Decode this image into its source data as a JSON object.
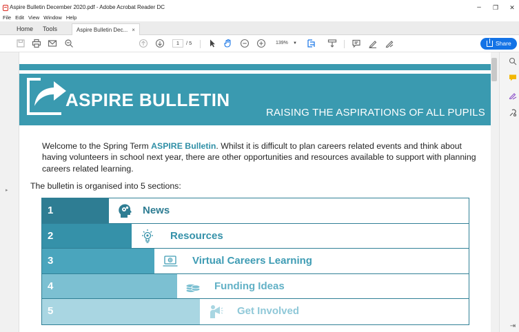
{
  "window": {
    "title": "Aspire Bulletin December 2020.pdf - Adobe Acrobat Reader DC",
    "minimize": "–",
    "maximize": "❐",
    "close": "✕"
  },
  "menu": [
    "File",
    "Edit",
    "View",
    "Window",
    "Help"
  ],
  "tabs": {
    "home": "Home",
    "tools": "Tools",
    "document": "Aspire Bulletin Dec...",
    "document_close": "×"
  },
  "toolbar": {
    "page_current": "1",
    "page_total": "/ 5",
    "zoom": "139%",
    "share_label": "Share"
  },
  "document": {
    "banner_title": "ASPIRE BULLETIN",
    "banner_subtitle": "RAISING THE ASPIRATIONS OF ALL PUPILS",
    "intro_prefix": "Welcome to the Spring Term ",
    "intro_bold": "ASPIRE Bulletin",
    "intro_suffix": ". Whilst it is difficult to plan careers related events and think about having volunteers in school next year, there are other opportunities and resources available to support with planning careers related learning.",
    "organised": "The bulletin is organised into 5 sections:",
    "sections": [
      {
        "number": "1",
        "label": "News",
        "fill": "#2e7d93",
        "label_color": "#2e7d93",
        "icon": "head-gears-icon"
      },
      {
        "number": "2",
        "label": "Resources",
        "fill": "#3591a9",
        "label_color": "#3591a9",
        "icon": "lightbulb-icon"
      },
      {
        "number": "3",
        "label": "Virtual Careers Learning",
        "fill": "#4aa5bd",
        "label_color": "#3f9cb4",
        "icon": "laptop-icon"
      },
      {
        "number": "4",
        "label": "Funding Ideas",
        "fill": "#7cc0d2",
        "label_color": "#62b1c6",
        "icon": "coins-icon"
      },
      {
        "number": "5",
        "label": "Get Involved",
        "fill": "#a9d6e2",
        "label_color": "#8fc8d8",
        "icon": "speaker-icon"
      }
    ]
  },
  "colors": {
    "banner": "#3a9ab0",
    "accent": "#1473e6"
  }
}
